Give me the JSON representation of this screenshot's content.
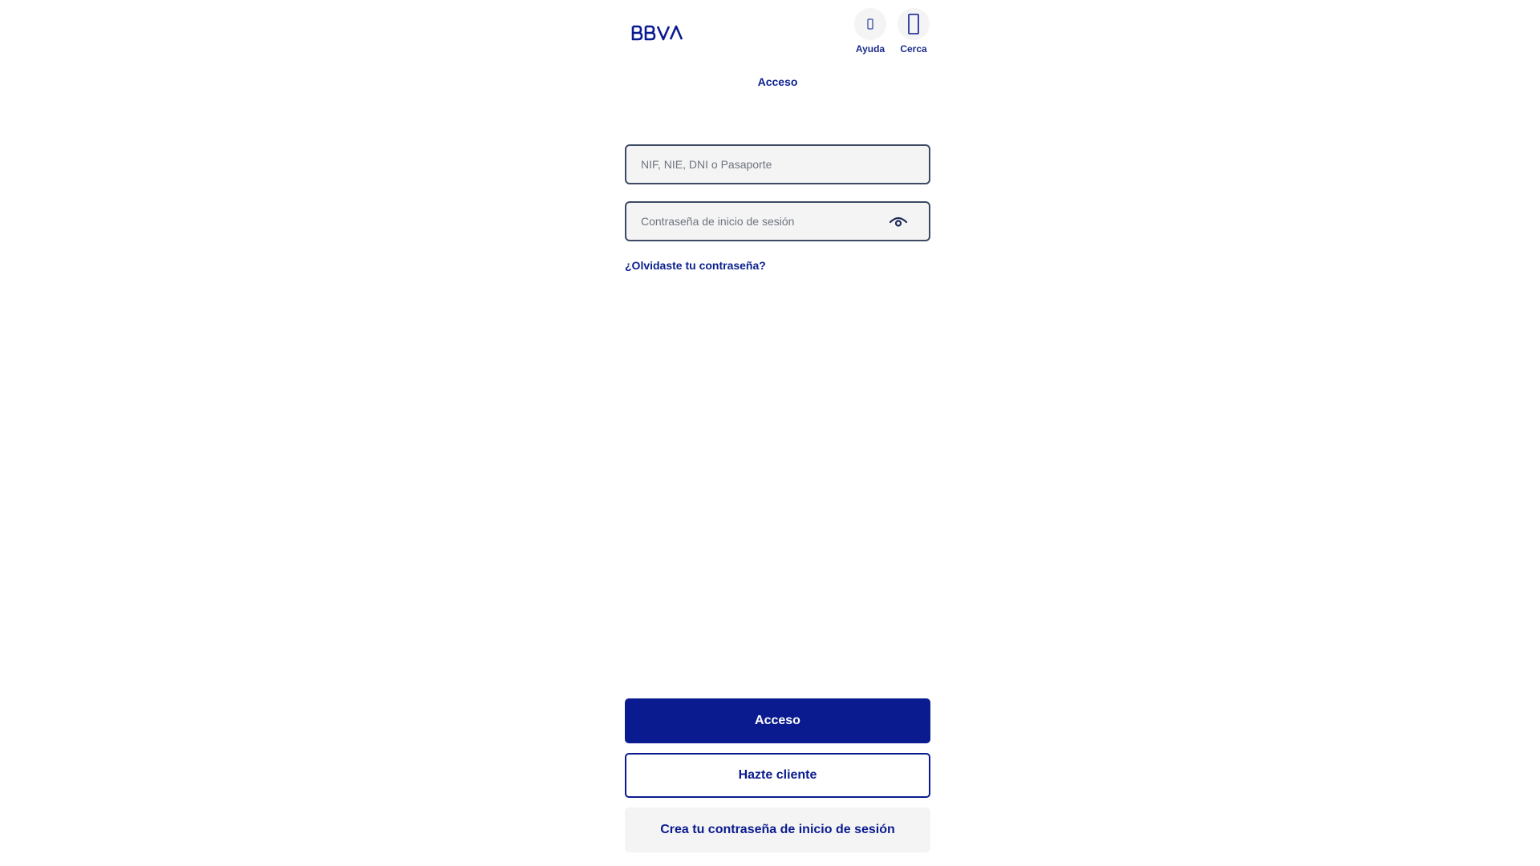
{
  "brand": {
    "logo_text": "BBVA",
    "primary_color": "#0a1b8f",
    "secondary_color": "#072146"
  },
  "header": {
    "actions": [
      {
        "label": "Ayuda",
        "icon": "help-icon"
      },
      {
        "label": "Cerca",
        "icon": "location-pin-icon"
      }
    ]
  },
  "page": {
    "title": "Acceso"
  },
  "form": {
    "user_field": {
      "placeholder": "NIF, NIE, DNI o Pasaporte",
      "value": ""
    },
    "password_field": {
      "placeholder": "Contraseña de inicio de sesión",
      "value": "",
      "toggle_icon": "eye-icon"
    },
    "forgot_link": "¿Olvidaste tu contraseña?"
  },
  "buttons": {
    "login": "Acceso",
    "become_client": "Hazte cliente",
    "create_password": "Crea tu contraseña de inicio de sesión"
  }
}
